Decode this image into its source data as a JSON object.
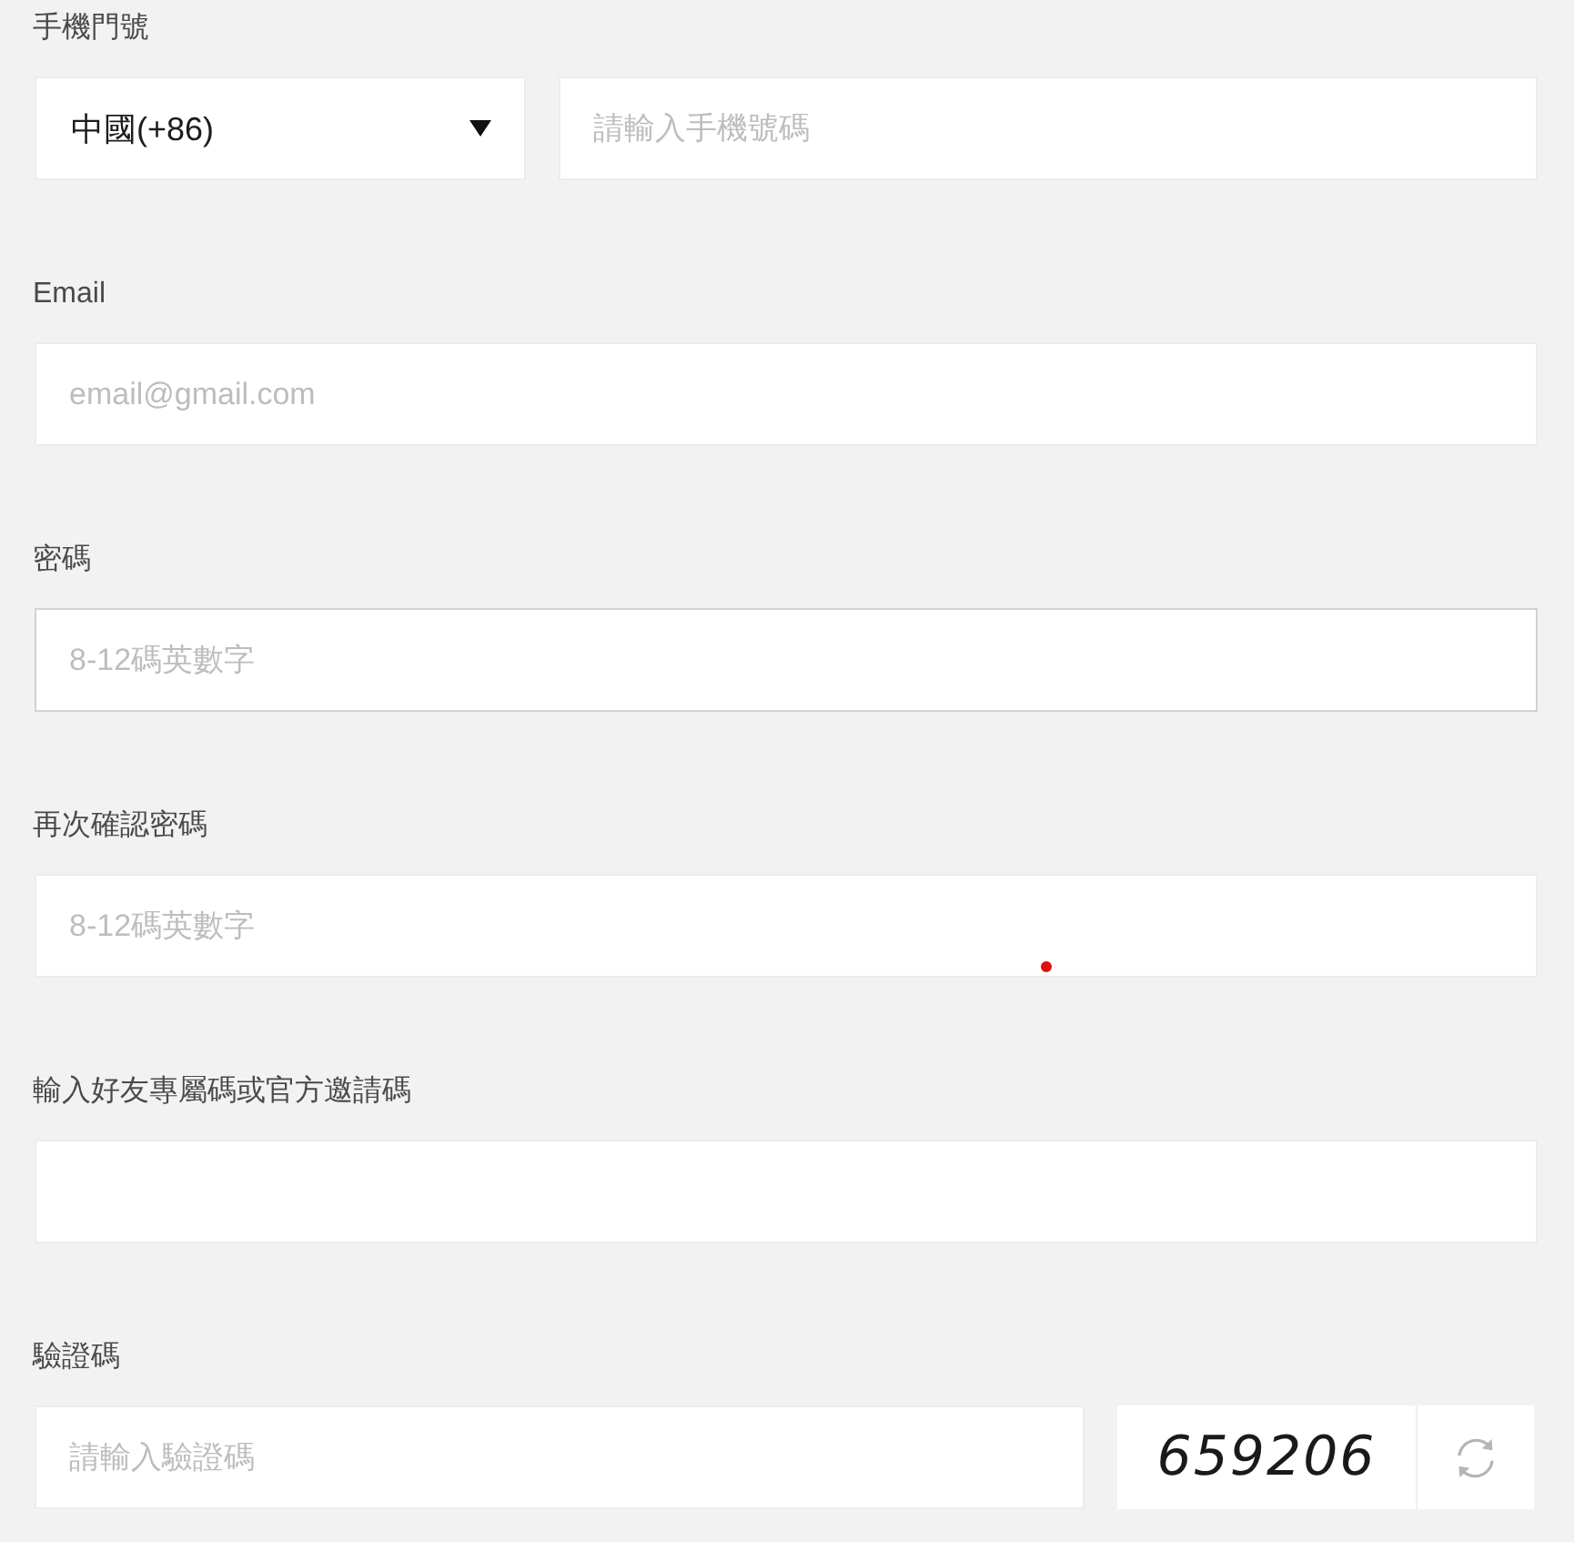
{
  "sections": [
    {
      "kind": "phone",
      "label": "手機門號",
      "country": {
        "value": "中國(+86)"
      },
      "field": {
        "placeholder": "請輸入手機號碼",
        "focused": false
      }
    },
    {
      "kind": "text",
      "label": "Email",
      "field": {
        "placeholder": "email@gmail.com",
        "focused": false
      }
    },
    {
      "kind": "text",
      "label": "密碼",
      "field": {
        "placeholder": "8-12碼英數字",
        "focused": true
      }
    },
    {
      "kind": "text",
      "label": "再次確認密碼",
      "field": {
        "placeholder": "8-12碼英數字",
        "focused": false
      }
    },
    {
      "kind": "text",
      "label": "輸入好友專屬碼或官方邀請碼",
      "field": {
        "focused": false
      }
    },
    {
      "kind": "captcha",
      "label": "驗證碼",
      "field": {
        "placeholder": "請輸入驗證碼",
        "focused": false
      },
      "captcha": {
        "code": "659206"
      }
    }
  ]
}
